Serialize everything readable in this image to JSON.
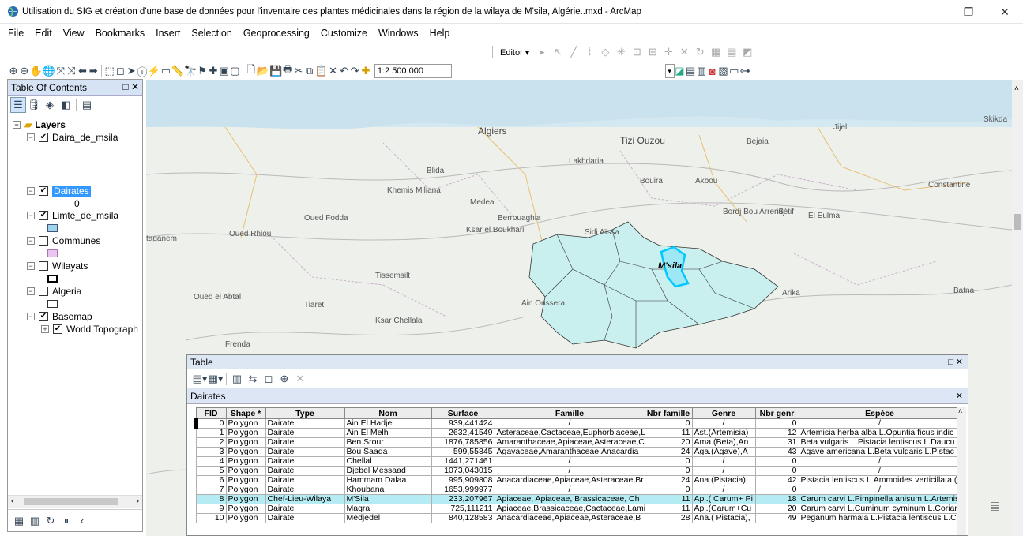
{
  "window": {
    "title": "Utilisation du SIG et création d'une base de données pour l'inventaire des  plantes médicinales dans  la région de la wilaya de M'sila, Algérie..mxd - ArcMap"
  },
  "menu": [
    "File",
    "Edit",
    "View",
    "Bookmarks",
    "Insert",
    "Selection",
    "Geoprocessing",
    "Customize",
    "Windows",
    "Help"
  ],
  "toolbar": {
    "editor_label": "Editor ▾",
    "scale_value": "1:2 500 000"
  },
  "toc": {
    "title": "Table Of Contents",
    "layers_label": "Layers",
    "items": [
      {
        "label": "Daira_de_msila",
        "checked": true
      },
      {
        "label": "Dairates",
        "checked": true,
        "legend": "0"
      },
      {
        "label": "Limte_de_msila",
        "checked": true
      },
      {
        "label": "Communes",
        "checked": false
      },
      {
        "label": "Wilayats",
        "checked": false
      },
      {
        "label": "Algeria",
        "checked": false
      },
      {
        "label": "Basemap",
        "checked": true
      },
      {
        "label": "World Topograph",
        "checked": true
      }
    ]
  },
  "map": {
    "labels": [
      "Algiers",
      "Tizi Ouzou",
      "Bejaia",
      "Jijel",
      "Skikda",
      "Lakhdaria",
      "Blida",
      "Medea",
      "Khemis Miliana",
      "Bouira",
      "Akbou",
      "Constantine",
      "Oued Fodda",
      "Berrouaghia",
      "Bordj Bou Arreridj",
      "Sétif",
      "El Eulma",
      "Oued Rhiou",
      "Ksar el Boukhari",
      "Sidi Aïssa",
      "taganem",
      "Tissemsilt",
      "Arika",
      "Batna",
      "Oued el Abtal",
      "Tiaret",
      "Ain Oussera",
      "Ksar Chellala",
      "Frenda",
      "M'sila"
    ],
    "colors": {
      "polygon": "#c9f0ee",
      "outline": "#333333",
      "highlight": "#00c8ff"
    }
  },
  "table": {
    "window_title": "Table",
    "tab_name": "Dairates",
    "columns": [
      "FID",
      "Shape *",
      "Type",
      "Nom",
      "Surface",
      "Famille",
      "Nbr famille",
      "Genre",
      "Nbr genr",
      "Espèce"
    ],
    "rows": [
      [
        "0",
        "Polygon",
        "Dairate",
        "Ain El Hadjel",
        "939,441424",
        "/",
        "0",
        "/",
        "0",
        "/"
      ],
      [
        "1",
        "Polygon",
        "Dairate",
        "Ain El Melh",
        "2632,41549",
        "Asteraceae,Cactaceae,Euphorbiaceae,L",
        "11",
        "Ast.(Artemisia)",
        "12",
        "Artemisia herba alba L.Opuntia ficus indic"
      ],
      [
        "2",
        "Polygon",
        "Dairate",
        "Ben Srour",
        "1876,785856",
        "Amaranthaceae,Apiaceae,Asteraceae,C",
        "20",
        "Ama.(Beta),An",
        "31",
        "Beta vulgaris L.Pistacia lentiscus L.Daucu"
      ],
      [
        "3",
        "Polygon",
        "Dairate",
        "Bou Saada",
        "599,55845",
        "Agavaceae,Amaranthaceae,Anacardia",
        "24",
        "Aga.(Agave),A",
        "43",
        "Agave  americana L.Beta vulgaris L.Pistac"
      ],
      [
        "4",
        "Polygon",
        "Dairate",
        "Chellal",
        "1441,271461",
        "/",
        "0",
        "/",
        "0",
        "/"
      ],
      [
        "5",
        "Polygon",
        "Dairate",
        "Djebel Messaad",
        "1073,043015",
        "/",
        "0",
        "/",
        "0",
        "/"
      ],
      [
        "6",
        "Polygon",
        "Dairate",
        "Hammam Dalaa",
        "995,909808",
        "Anacardiaceae,Apiaceae,Asteraceae,Br",
        "24",
        "Ana.(Pistacia),",
        "42",
        "Pistacia lentiscus L.Ammoides verticillata.("
      ],
      [
        "7",
        "Polygon",
        "Dairate",
        "Khoubana",
        "1653,999977",
        "/",
        "0",
        "/",
        "0",
        "/"
      ],
      [
        "8",
        "Polygon",
        "Chef-Lieu-Wilaya",
        "M'Sila",
        "233,207967",
        "Apiaceae, Apiaceae, Brassicaceae, Ch",
        "11",
        "Api.( Carum+ Pi",
        "18",
        "Carum carvi L.Pimpinella anisum L.Artemis"
      ],
      [
        "9",
        "Polygon",
        "Dairate",
        "Magra",
        "725,111211",
        "Apiaceae,Brassicaceae,Cactaceae,Lami",
        "11",
        "Api.(Carum+Cu",
        "20",
        "Carum carvi L.Cuminum cyminum L.Corian"
      ],
      [
        "10",
        "Polygon",
        "Dairate",
        "Medjedel",
        "840,128583",
        "Anacardiaceae,Apiaceae,Asteraceae,B",
        "28",
        "Ana.( Pistacia),",
        "49",
        "Peganum harmala L.Pistacia lentiscus L.C"
      ]
    ],
    "highlight_row": 8
  }
}
